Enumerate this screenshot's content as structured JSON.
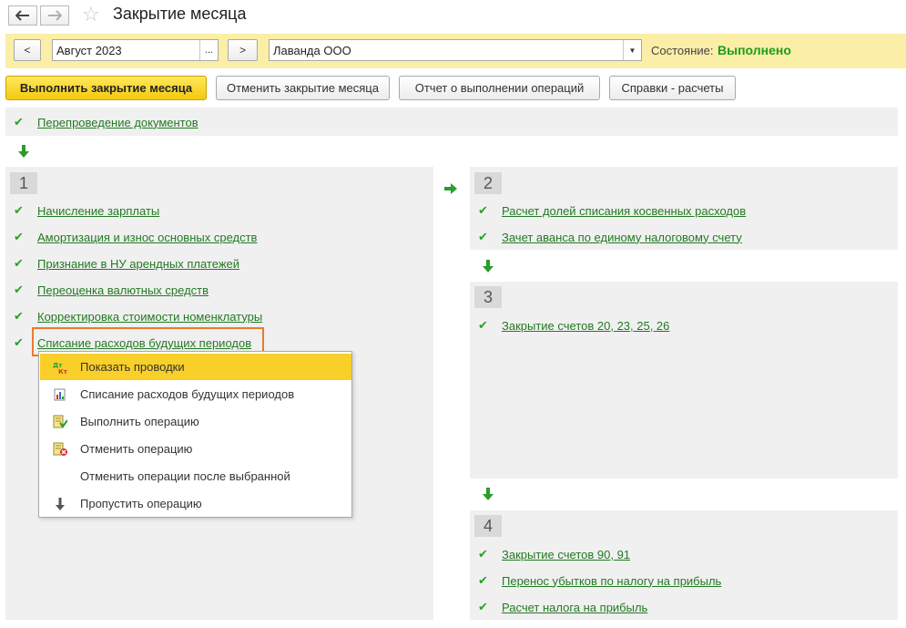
{
  "window": {
    "title": "Закрытие месяца"
  },
  "period": {
    "prev_label": "<",
    "next_label": ">",
    "value": "Август 2023",
    "select_label": "..."
  },
  "organization": {
    "value": "Лаванда ООО"
  },
  "status": {
    "label": "Состояние:",
    "value": "Выполнено",
    "color": "#1c9c1c"
  },
  "toolbar": {
    "run_label": "Выполнить закрытие месяца",
    "cancel_label": "Отменить закрытие месяца",
    "report_label": "Отчет о выполнении операций",
    "calc_label": "Справки - расчеты"
  },
  "pre_step": {
    "operations": [
      "Перепроведение документов"
    ]
  },
  "steps": [
    {
      "number": "1",
      "operations": [
        "Начисление зарплаты",
        "Амортизация и износ основных средств",
        "Признание в НУ арендных платежей",
        "Переоценка валютных средств",
        "Корректировка стоимости номенклатуры",
        "Списание расходов будущих периодов"
      ]
    },
    {
      "number": "2",
      "operations": [
        "Расчет долей списания косвенных расходов",
        "Зачет аванса по единому налоговому счету"
      ]
    },
    {
      "number": "3",
      "operations": [
        "Закрытие счетов 20, 23, 25, 26"
      ]
    },
    {
      "number": "4",
      "operations": [
        "Закрытие счетов 90, 91",
        "Перенос убытков по налогу на прибыль",
        "Расчет налога на прибыль"
      ]
    }
  ],
  "context_menu": {
    "items": [
      {
        "label": "Показать проводки",
        "icon": "dt-kt-icon",
        "active": true
      },
      {
        "label": "Списание расходов будущих периодов",
        "icon": "report-icon"
      },
      {
        "label": "Выполнить операцию",
        "icon": "run-operation-icon"
      },
      {
        "label": "Отменить операцию",
        "icon": "cancel-operation-icon"
      },
      {
        "label": "Отменить операции после выбранной",
        "icon": ""
      },
      {
        "label": "Пропустить операцию",
        "icon": "skip-arrow-icon"
      }
    ]
  },
  "colors": {
    "accent_yellow": "#f9cf2a",
    "panel_yellow": "#fbeea6",
    "link_green": "#237a23",
    "highlight_orange": "#ee7a28"
  }
}
